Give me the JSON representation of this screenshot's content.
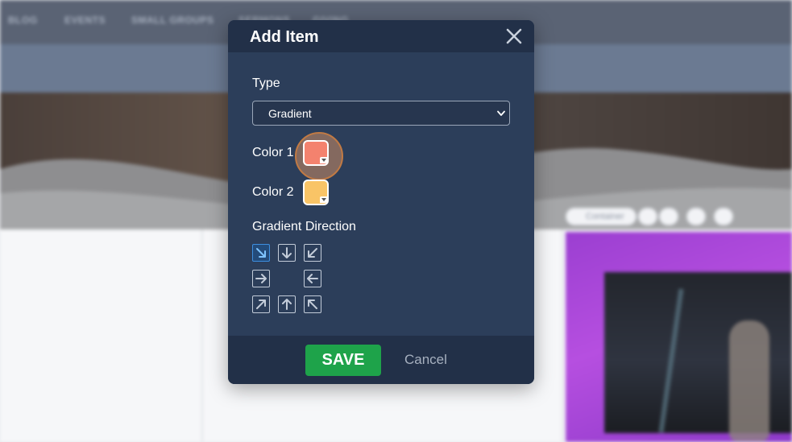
{
  "background": {
    "nav_items": [
      "BLOG",
      "EVENTS",
      "SMALL GROUPS",
      "SERMONS",
      "GIVING"
    ],
    "container_toolbar_label": "Container"
  },
  "modal": {
    "title": "Add Item",
    "close_icon": "close-icon",
    "type": {
      "label": "Type",
      "selected": "Gradient"
    },
    "color1": {
      "label": "Color 1",
      "value": "#f4826e"
    },
    "color2": {
      "label": "Color 2",
      "value": "#f9c466"
    },
    "gradient_direction": {
      "label": "Gradient Direction",
      "selected": "down-right",
      "options": [
        "down-right",
        "down",
        "down-left",
        "right",
        "left",
        "up-right",
        "up",
        "up-left"
      ]
    },
    "save_label": "SAVE",
    "cancel_label": "Cancel"
  },
  "colors": {
    "modal_bg": "#2c3e5a",
    "header_bg": "#223048",
    "save_green": "#1ea34a",
    "selected_blue": "#3d8fe0"
  }
}
